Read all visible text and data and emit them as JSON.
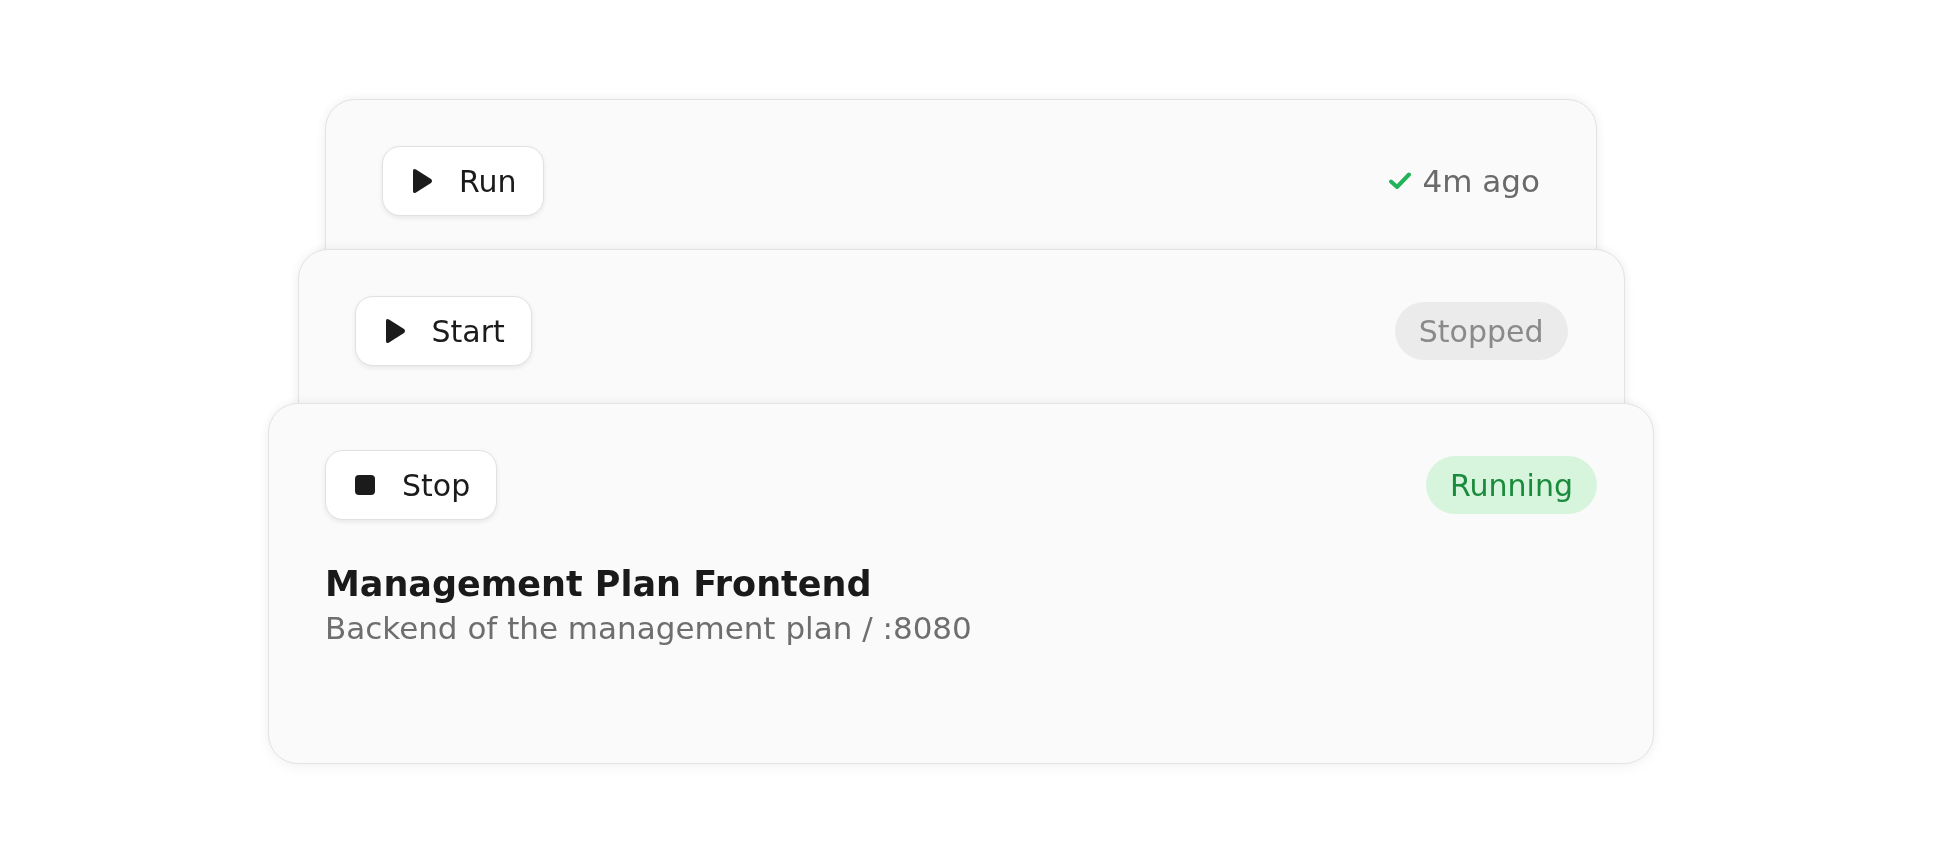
{
  "cards": [
    {
      "button": {
        "label": "Run",
        "kind": "play"
      },
      "status": {
        "kind": "time",
        "text": "4m ago"
      }
    },
    {
      "button": {
        "label": "Start",
        "kind": "play"
      },
      "status": {
        "kind": "stopped",
        "text": "Stopped"
      }
    },
    {
      "button": {
        "label": "Stop",
        "kind": "stop"
      },
      "status": {
        "kind": "running",
        "text": "Running"
      },
      "title": "Management Plan Frontend",
      "subtitle": "Backend of the management plan / :8080"
    }
  ]
}
